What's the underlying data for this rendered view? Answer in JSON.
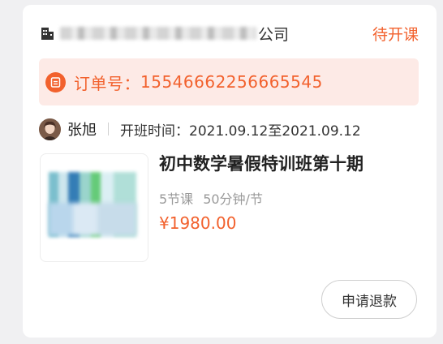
{
  "header": {
    "company_suffix": "公司",
    "status": "待开课"
  },
  "order": {
    "label": "订单号：",
    "number": "15546662256665545"
  },
  "teacher": {
    "name": "张旭",
    "time_label": "开班时间：",
    "time_range": "2021.09.12至2021.09.12"
  },
  "course": {
    "title": "初中数学暑假特训班第十期",
    "lessons": "5节课",
    "duration": "50分钟/节",
    "price": "¥1980.00"
  },
  "actions": {
    "refund_label": "申请退款"
  },
  "colors": {
    "accent": "#f2612d",
    "order_bg": "#fdeae6"
  }
}
